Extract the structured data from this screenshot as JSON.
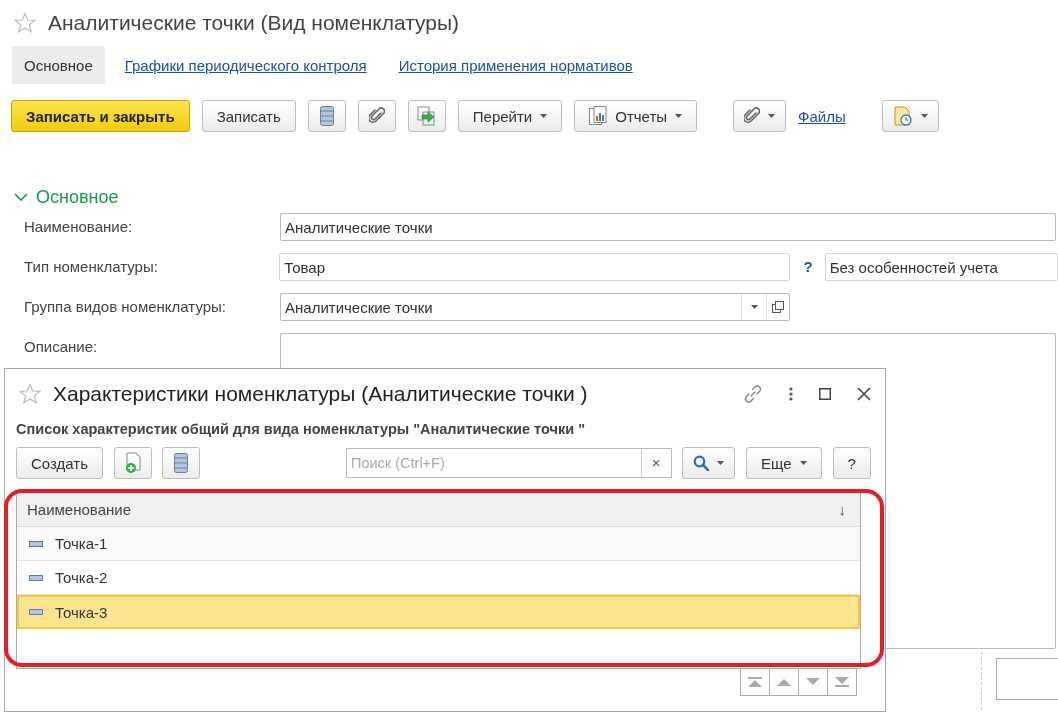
{
  "window": {
    "title": "Аналитические точки (Вид номенклатуры)",
    "favorite": false
  },
  "tabs": [
    {
      "label": "Основное",
      "selected": true
    },
    {
      "label": "Графики периодического контроля",
      "selected": false
    },
    {
      "label": "История применения нормативов",
      "selected": false
    }
  ],
  "toolbar": {
    "save_close": "Записать и закрыть",
    "save": "Записать",
    "goto": "Перейти",
    "reports": "Отчеты",
    "files": "Файлы"
  },
  "section": {
    "title": "Основное",
    "expanded": true
  },
  "fields": [
    {
      "kind": "text",
      "label": "Наименование:",
      "value": "Аналитические точки"
    },
    {
      "kind": "type",
      "label": "Тип номенклатуры:",
      "value": "Товар",
      "help": "?",
      "extra": "Без особенностей учета"
    },
    {
      "kind": "select",
      "label": "Группа видов номенклатуры:",
      "value": "Аналитические точки"
    },
    {
      "kind": "textarea",
      "label": "Описание:"
    }
  ],
  "dialog": {
    "title": "Характеристики номенклатуры (Аналитические точки )",
    "favorite": false,
    "subtitle": "Список характеристик общий для вида номенклатуры \"Аналитические точки \"",
    "create": "Создать",
    "search": {
      "placeholder": "Поиск (Ctrl+F)",
      "clear": "×"
    },
    "more": "Еще",
    "help": "?",
    "columns": [
      {
        "label": "Наименование",
        "sort": "↓"
      }
    ],
    "rows": [
      {
        "name": "Точка-1",
        "selected": false
      },
      {
        "name": "Точка-2",
        "selected": false
      },
      {
        "name": "Точка-3",
        "selected": true
      }
    ]
  }
}
